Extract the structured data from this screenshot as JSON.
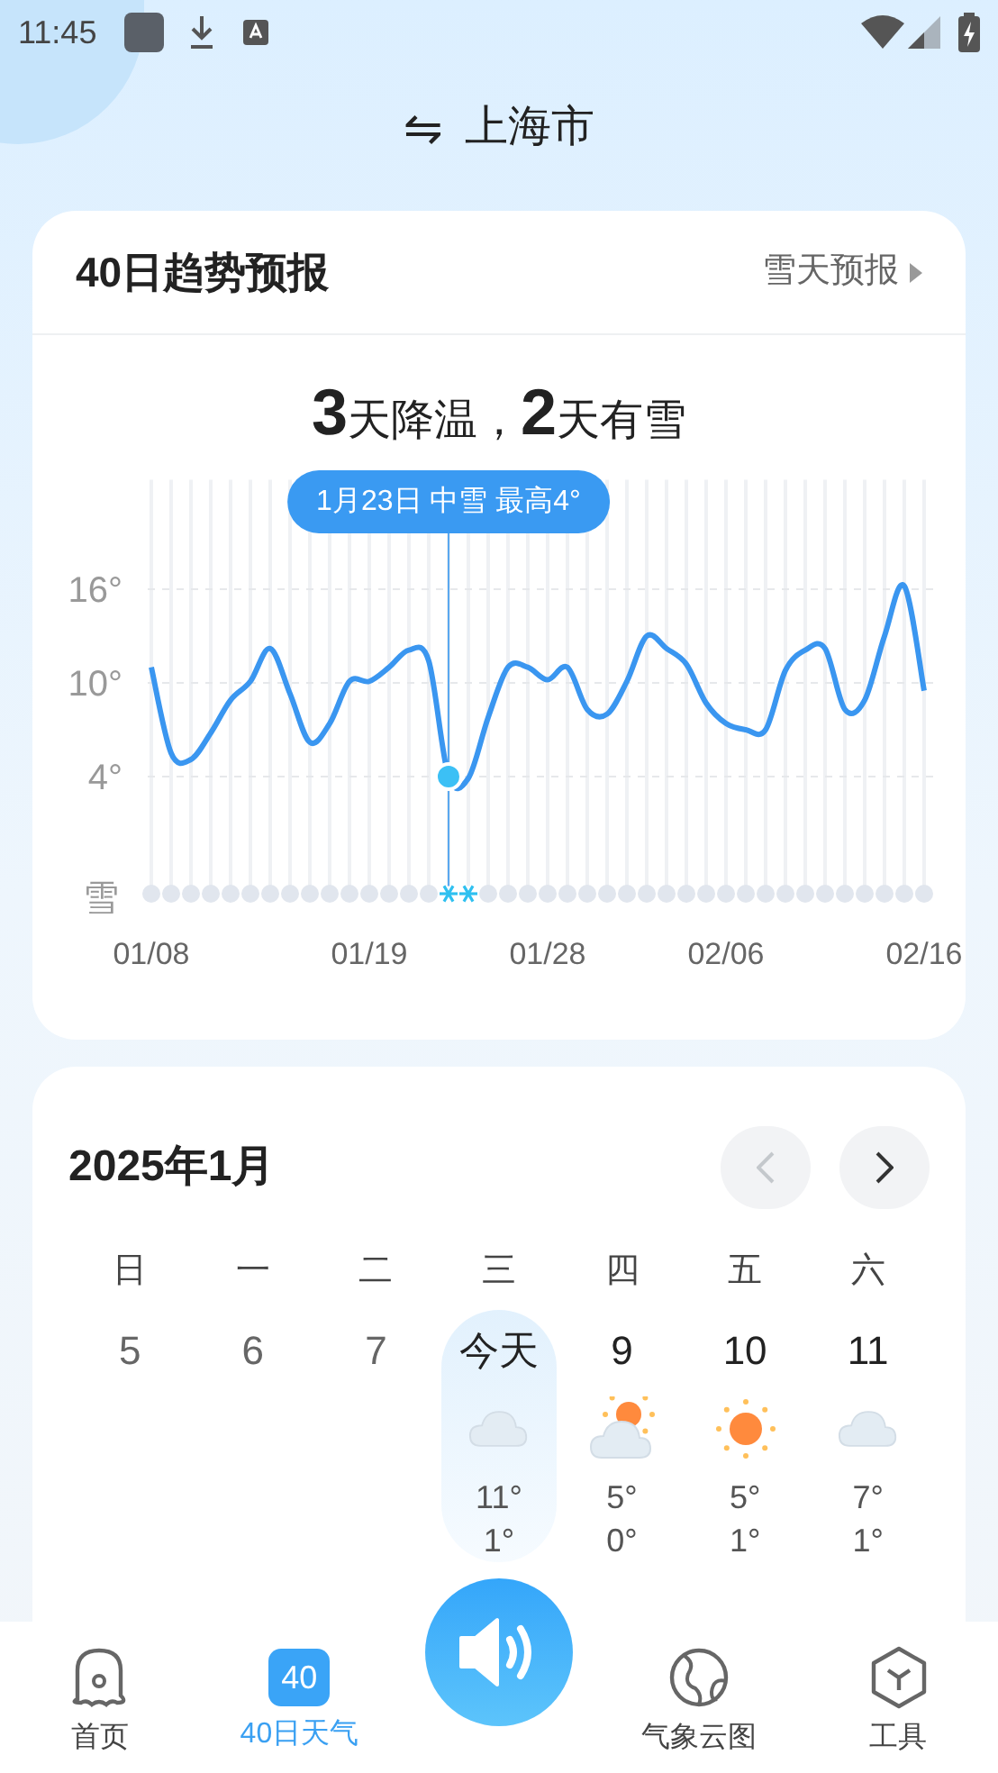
{
  "status_bar": {
    "time": "11:45"
  },
  "header": {
    "city": "上海市",
    "switch_icon": "⇋"
  },
  "trend_card": {
    "title": "40日趋势预报",
    "link": "雪天预报",
    "headline": "**3**天降温，**2**天有雪",
    "chart_data": {
      "type": "line",
      "grid": true,
      "categories": [
        "01/08",
        null,
        null,
        null,
        null,
        null,
        null,
        null,
        null,
        null,
        null,
        "01/19",
        null,
        null,
        null,
        null,
        null,
        null,
        null,
        null,
        "01/28",
        null,
        null,
        null,
        null,
        null,
        null,
        null,
        null,
        "02/06",
        null,
        null,
        null,
        null,
        null,
        null,
        null,
        null,
        null,
        "02/16"
      ],
      "series": [
        {
          "color": "#3a96f0",
          "values": [
            11.0,
            5.5,
            5.1,
            6.8,
            8.9,
            10.1,
            12.2,
            9.3,
            6.2,
            7.4,
            10.1,
            10.1,
            11.0,
            12.1,
            11.4,
            4.0,
            3.9,
            7.8,
            11.0,
            11.0,
            10.2,
            11.0,
            8.3,
            8.0,
            10.1,
            13.0,
            12.2,
            11.2,
            8.7,
            7.4,
            7.0,
            7.0,
            10.8,
            12.1,
            12.2,
            8.3,
            8.9,
            13.0,
            16.2,
            9.5
          ]
        }
      ],
      "ylim": [
        -3,
        23
      ],
      "yticks": [
        {
          "value": 4,
          "label": "4°"
        },
        {
          "value": 10,
          "label": "10°"
        },
        {
          "value": 16,
          "label": "16°"
        }
      ]
    },
    "tooltip": "1月23日 中雪 最高4°",
    "snow_row": {
      "label": "雪",
      "days": [
        {
          "snow": false,
          "selected": false
        },
        {
          "snow": false,
          "selected": false
        },
        {
          "snow": false,
          "selected": false
        },
        {
          "snow": false,
          "selected": false
        },
        {
          "snow": false,
          "selected": false
        },
        {
          "snow": false,
          "selected": false
        },
        {
          "snow": false,
          "selected": false
        },
        {
          "snow": false,
          "selected": false
        },
        {
          "snow": false,
          "selected": false
        },
        {
          "snow": false,
          "selected": false
        },
        {
          "snow": false,
          "selected": false
        },
        {
          "snow": false,
          "selected": false
        },
        {
          "snow": false,
          "selected": false
        },
        {
          "snow": false,
          "selected": false
        },
        {
          "snow": false,
          "selected": false
        },
        {
          "snow": true,
          "selected": true
        },
        {
          "snow": true,
          "selected": false
        },
        {
          "snow": false,
          "selected": false
        },
        {
          "snow": false,
          "selected": false
        },
        {
          "snow": false,
          "selected": false
        },
        {
          "snow": false,
          "selected": false
        },
        {
          "snow": false,
          "selected": false
        },
        {
          "snow": false,
          "selected": false
        },
        {
          "snow": false,
          "selected": false
        },
        {
          "snow": false,
          "selected": false
        },
        {
          "snow": false,
          "selected": false
        },
        {
          "snow": false,
          "selected": false
        },
        {
          "snow": false,
          "selected": false
        },
        {
          "snow": false,
          "selected": false
        },
        {
          "snow": false,
          "selected": false
        },
        {
          "snow": false,
          "selected": false
        },
        {
          "snow": false,
          "selected": false
        },
        {
          "snow": false,
          "selected": false
        },
        {
          "snow": false,
          "selected": false
        },
        {
          "snow": false,
          "selected": false
        },
        {
          "snow": false,
          "selected": false
        },
        {
          "snow": false,
          "selected": false
        },
        {
          "snow": false,
          "selected": false
        },
        {
          "snow": false,
          "selected": false
        },
        {
          "snow": false,
          "selected": false
        }
      ]
    }
  },
  "calendar": {
    "title": "2025年1月",
    "prev_disabled": true,
    "weekdays": [
      "日",
      "一",
      "二",
      "三",
      "四",
      "五",
      "六"
    ],
    "days": [
      {
        "label": "5",
        "past": true,
        "selected": false
      },
      {
        "label": "6",
        "past": true,
        "selected": false
      },
      {
        "label": "7",
        "past": true,
        "selected": false
      },
      {
        "label": "今天",
        "past": false,
        "selected": true,
        "kind": "cloudy",
        "high": "11°",
        "low": "1°"
      },
      {
        "label": "9",
        "past": false,
        "selected": false,
        "kind": "partly_cloudy",
        "high": "5°",
        "low": "0°"
      },
      {
        "label": "10",
        "past": false,
        "selected": false,
        "kind": "sunny",
        "high": "5°",
        "low": "1°"
      },
      {
        "label": "11",
        "past": false,
        "selected": false,
        "kind": "cloudy",
        "high": "7°",
        "low": "1°"
      }
    ]
  },
  "bottom_nav": [
    {
      "label": "首页",
      "kind": "home",
      "selected": false
    },
    {
      "label": "40日天气",
      "kind": "calendar",
      "badge": "40",
      "selected": true
    },
    {
      "kind": "voice"
    },
    {
      "label": "气象云图",
      "kind": "globe",
      "selected": false
    },
    {
      "label": "工具",
      "kind": "tools",
      "selected": false
    }
  ]
}
